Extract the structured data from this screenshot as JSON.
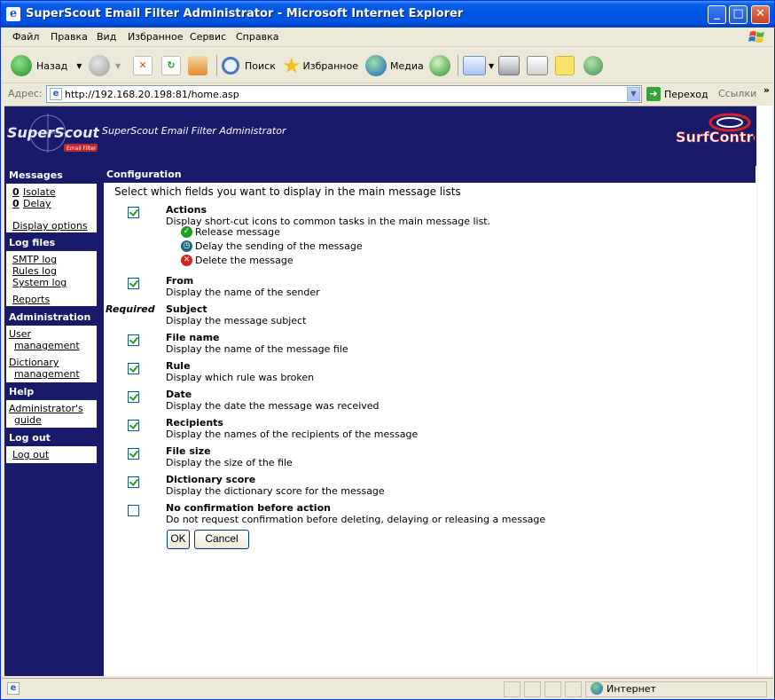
{
  "window": {
    "title": "SuperScout Email Filter Administrator - Microsoft Internet Explorer",
    "min_label": "_",
    "max_label": "□",
    "close_label": "✕"
  },
  "menu": [
    "Файл",
    "Правка",
    "Вид",
    "Избранное",
    "Сервис",
    "Справка"
  ],
  "toolbar": {
    "back": "Назад",
    "search": "Поиск",
    "favorites": "Избранное",
    "media": "Медиа"
  },
  "address": {
    "label": "Адрес:",
    "url": "http://192.168.20.198:81/home.asp",
    "go": "Переход",
    "links": "Ссылки"
  },
  "banner": {
    "logo_text": "SuperScout",
    "logo_sub": "Email Filter",
    "app_name": "SuperScout Email Filter Administrator",
    "brand": "SurfControl"
  },
  "sidebar": {
    "messages": {
      "heading": "Messages",
      "isolate_count": "0",
      "isolate": "Isolate",
      "delay_count": "0",
      "delay": "Delay",
      "display_options": "Display options"
    },
    "logfiles": {
      "heading": "Log files",
      "smtp": "SMTP log",
      "rules": "Rules log",
      "system": "System log",
      "reports": "Reports"
    },
    "administration": {
      "heading": "Administration",
      "user1": "User",
      "user2": "management",
      "dict1": "Dictionary",
      "dict2": "management"
    },
    "help": {
      "heading": "Help",
      "guide1": "Administrator's",
      "guide2": "guide"
    },
    "logout": {
      "heading": "Log out",
      "link": "Log out"
    }
  },
  "main": {
    "heading": "Configuration",
    "intro": "Select which fields you want to display in the main message lists",
    "required": "Required",
    "rows": [
      {
        "label": "Actions",
        "desc": "Display short-cut icons to common tasks in the main message list.",
        "checked": true
      },
      {
        "label": "From",
        "desc": "Display the name of the sender",
        "checked": true
      },
      {
        "label": "Subject",
        "desc": "Display the message subject",
        "checked": null
      },
      {
        "label": "File name",
        "desc": "Display the name of the message file",
        "checked": true
      },
      {
        "label": "Rule",
        "desc": "Display which rule was broken",
        "checked": true
      },
      {
        "label": "Date",
        "desc": "Display the date the message was received",
        "checked": true
      },
      {
        "label": "Recipients",
        "desc": "Display the names of the recipients of the message",
        "checked": true
      },
      {
        "label": "File size",
        "desc": "Display the size of the file",
        "checked": true
      },
      {
        "label": "Dictionary score",
        "desc": "Display the dictionary score for the message",
        "checked": true
      },
      {
        "label": "No confirmation before action",
        "desc": "Do not request confirmation before deleting, delaying or releasing a message",
        "checked": false
      }
    ],
    "actions": {
      "release": "Release message",
      "delay": "Delay the sending of the message",
      "delete": "Delete the message"
    },
    "ok": "OK",
    "cancel": "Cancel"
  },
  "status": {
    "zone": "Интернет"
  },
  "colors": {
    "navy": "#1a1a6b",
    "titlebar": "#0054e3",
    "check": "#21a121"
  }
}
